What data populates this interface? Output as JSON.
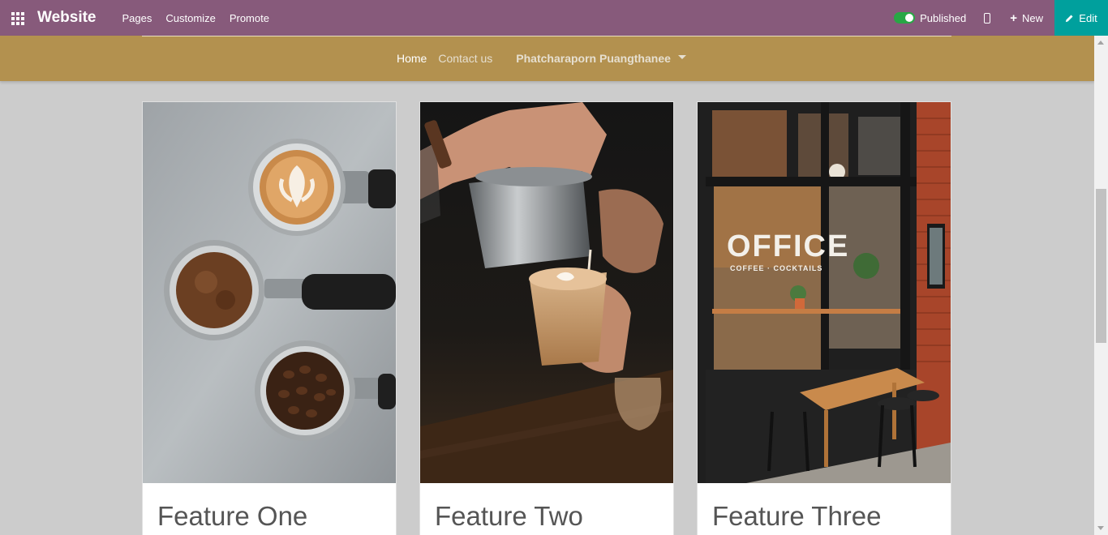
{
  "topbar": {
    "brand": "Website",
    "menu": [
      "Pages",
      "Customize",
      "Promote"
    ],
    "published_label": "Published",
    "new_label": "New",
    "edit_label": "Edit",
    "colors": {
      "bar": "#875a7b",
      "edit": "#00a09d",
      "toggle_on": "#28a745"
    }
  },
  "site": {
    "nav": {
      "home": "Home",
      "contact": "Contact us",
      "user": "Phatcharaporn Puangthanee"
    },
    "header_color": "#b3914f"
  },
  "cards": [
    {
      "title": "Feature One",
      "image": "espresso-portafilters-photo"
    },
    {
      "title": "Feature Two",
      "image": "barista-pouring-latte-photo"
    },
    {
      "title": "Feature Three",
      "image": "office-coffee-storefront-photo"
    }
  ]
}
